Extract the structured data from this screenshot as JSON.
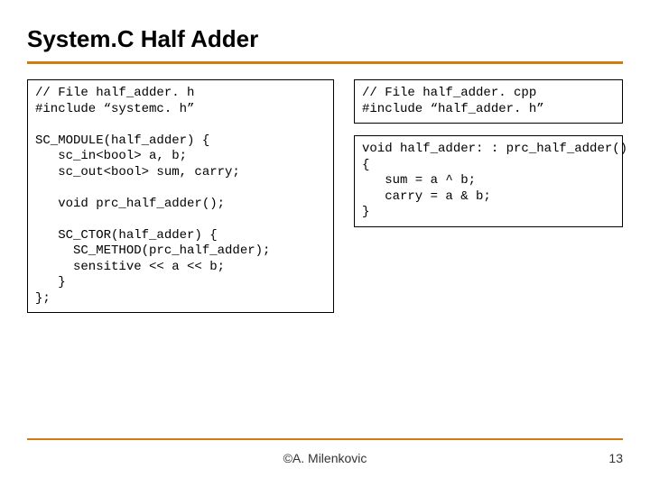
{
  "title": "System.C Half Adder",
  "code_left": "// File half_adder. h\n#include “systemc. h”\n\nSC_MODULE(half_adder) {\n   sc_in<bool> a, b;\n   sc_out<bool> sum, carry;\n\n   void prc_half_adder();\n\n   SC_CTOR(half_adder) {\n     SC_METHOD(prc_half_adder);\n     sensitive << a << b;\n   }\n};",
  "code_right_top": "// File half_adder. cpp\n#include “half_adder. h”",
  "code_right_bottom": "void half_adder: : prc_half_adder()\n{\n   sum = a ^ b;\n   carry = a & b;\n}",
  "footer_author": "©A. Milenkovic",
  "footer_page": "13"
}
